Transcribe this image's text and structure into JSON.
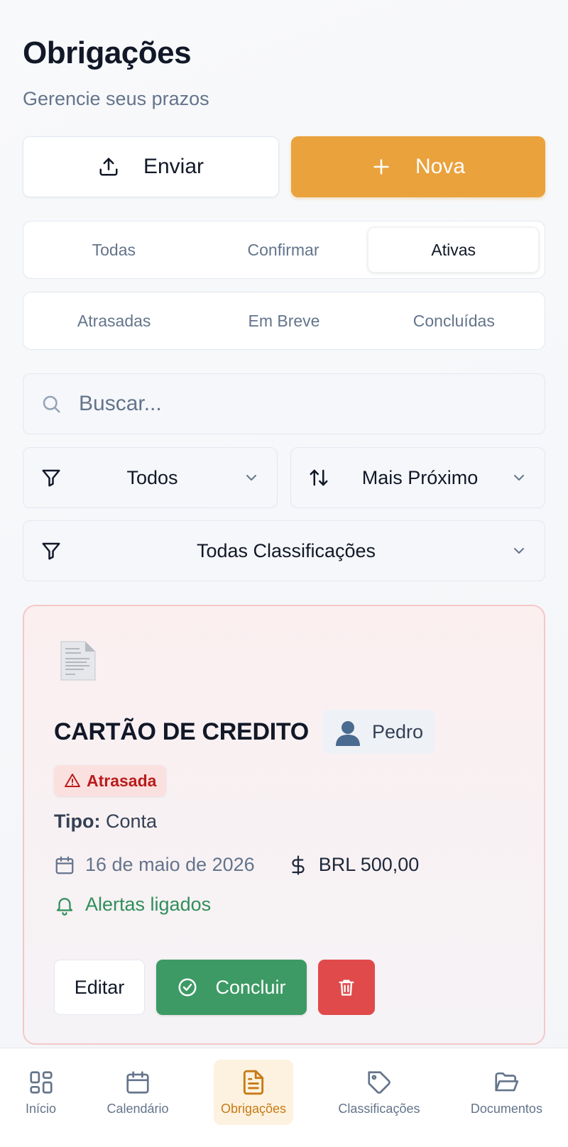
{
  "header": {
    "title": "Obrigações",
    "subtitle": "Gerencie seus prazos"
  },
  "actions": {
    "upload_label": "Enviar",
    "new_label": "Nova"
  },
  "status_tabs": [
    {
      "label": "Todas",
      "active": false
    },
    {
      "label": "Confirmar",
      "active": false
    },
    {
      "label": "Ativas",
      "active": true
    }
  ],
  "time_tabs": [
    {
      "label": "Atrasadas"
    },
    {
      "label": "Em Breve"
    },
    {
      "label": "Concluídas"
    }
  ],
  "search": {
    "placeholder": "Buscar...",
    "value": ""
  },
  "filters": {
    "type_value": "Todos",
    "sort_value": "Mais Próximo",
    "classification_value": "Todas Classificações"
  },
  "obligation": {
    "title": "CARTÃO DE CREDITO",
    "person": "Pedro",
    "status": "Atrasada",
    "type_label": "Tipo:",
    "type_value": "Conta",
    "due_date": "16 de maio de 2026",
    "amount": "BRL 500,00",
    "alerts": "Alertas ligados",
    "edit_label": "Editar",
    "complete_label": "Concluir"
  },
  "bottom_nav": [
    {
      "label": "Início",
      "icon": "grid-icon"
    },
    {
      "label": "Calendário",
      "icon": "calendar-icon"
    },
    {
      "label": "Obrigações",
      "icon": "document-icon",
      "active": true
    },
    {
      "label": "Classificações",
      "icon": "tag-icon"
    },
    {
      "label": "Documentos",
      "icon": "folder-icon"
    }
  ],
  "colors": {
    "accent": "#eaa23c",
    "success": "#3d9a65",
    "danger": "#e04a4a",
    "overdue_text": "#b91c1c"
  }
}
